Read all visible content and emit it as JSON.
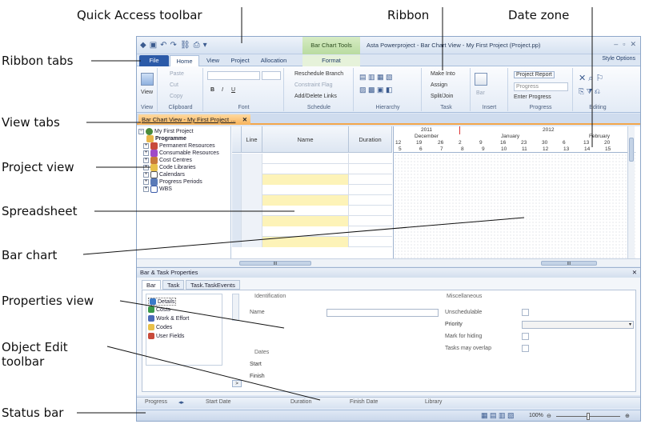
{
  "callouts": {
    "qat": "Quick Access toolbar",
    "ribbon": "Ribbon",
    "datezone": "Date zone",
    "ribbon_tabs": "Ribbon tabs",
    "view_tabs": "View tabs",
    "project_view": "Project view",
    "spreadsheet": "Spreadsheet",
    "bar_chart": "Bar chart",
    "properties_view": "Properties view",
    "object_edit_1": "Object Edit",
    "object_edit_2": "toolbar",
    "status_bar": "Status bar"
  },
  "titlebar": {
    "context_tab": "Bar Chart Tools",
    "title": "Asta Powerproject - Bar Chart View - My First Project (Project.pp)"
  },
  "tabs": {
    "file": "File",
    "home": "Home",
    "view": "View",
    "project": "Project",
    "allocation": "Allocation",
    "format": "Format",
    "style_options": "Style Options"
  },
  "ribbon": {
    "view_btn": "View",
    "view_group": "View",
    "paste": "Paste",
    "cut": "Cut",
    "copy": "Copy",
    "clipboard_group": "Clipboard",
    "bold": "B",
    "italic": "I",
    "underline": "U",
    "font_group": "Font",
    "reschedule": "Reschedule Branch",
    "constraint": "Constraint Flag",
    "add_delete": "Add/Delete Links",
    "schedule_group": "Schedule",
    "hierarchy_group": "Hierarchy",
    "make_into": "Make Into",
    "assign": "Assign",
    "split_join": "Split/Join",
    "task_group": "Task",
    "bar": "Bar",
    "insert_group": "Insert",
    "project_report": "Project Report",
    "progress": "Progress",
    "enter_progress": "Enter Progress",
    "progress_group": "Progress",
    "editing_group": "Editing"
  },
  "doc_tab": "Bar Chart View - My First Project ...",
  "project_tree": [
    "My First Project",
    "Programme",
    "Permanent Resources",
    "Consumable Resources",
    "Cost Centres",
    "Code Libraries",
    "Calendars",
    "Progress Periods",
    "WBS"
  ],
  "columns": {
    "line": "Line",
    "name": "Name",
    "duration": "Duration"
  },
  "datezone": {
    "years": [
      "2011",
      "2012"
    ],
    "months": [
      "December",
      "January",
      "February"
    ],
    "days": [
      "12",
      "19",
      "26",
      "2",
      "9",
      "16",
      "23",
      "30",
      "6",
      "13",
      "20"
    ],
    "weeks": [
      "5",
      "6",
      "7",
      "8",
      "9",
      "10",
      "11",
      "12",
      "13",
      "14",
      "15"
    ]
  },
  "scroll_mark": "III",
  "props": {
    "title": "Bar & Task Properties",
    "pin": "✕",
    "tabs": [
      "Bar",
      "Task",
      "Task.TaskEvents"
    ],
    "categories": [
      "Details",
      "Costs",
      "Work & Effort",
      "Codes",
      "User Fields"
    ],
    "identification": "Identification",
    "name": "Name",
    "dates": "Dates",
    "start": "Start",
    "finish": "Finish",
    "misc": "Miscellaneous",
    "unschedulable": "Unschedulable",
    "priority": "Priority",
    "mark_hiding": "Mark for hiding",
    "tasks_overlap": "Tasks may overlap"
  },
  "oe_toolbar": {
    "progress": "Progress",
    "start_date": "Start Date",
    "duration": "Duration",
    "finish_date": "Finish Date",
    "library": "Library"
  },
  "status": {
    "zoom": "100%"
  },
  "colors": {
    "accent": "#2b5aa8",
    "doc_tab": "#f7b35a",
    "highlight_row": "#fdf3b8"
  }
}
